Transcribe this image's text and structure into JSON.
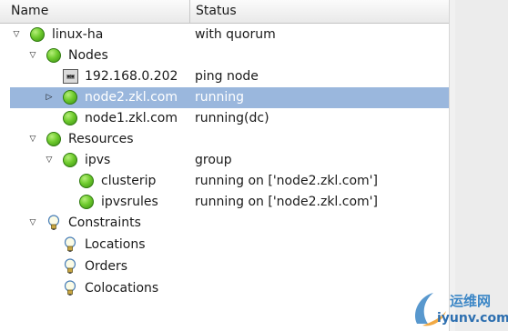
{
  "columns": {
    "name": "Name",
    "status": "Status"
  },
  "tree": {
    "root": {
      "label": "linux-ha",
      "status": "with quorum"
    },
    "nodes": {
      "label": "Nodes"
    },
    "ping_node": {
      "label": "192.168.0.202",
      "status": "ping node"
    },
    "node2": {
      "label": "node2.zkl.com",
      "status": "running"
    },
    "node1": {
      "label": "node1.zkl.com",
      "status": "running(dc)"
    },
    "resources": {
      "label": "Resources"
    },
    "ipvs": {
      "label": "ipvs",
      "status": "group"
    },
    "clusterip": {
      "label": "clusterip",
      "status": "running on ['node2.zkl.com']"
    },
    "ipvsrules": {
      "label": "ipvsrules",
      "status": "running on ['node2.zkl.com']"
    },
    "constraints": {
      "label": "Constraints"
    },
    "locations": {
      "label": "Locations"
    },
    "orders": {
      "label": "Orders"
    },
    "colocations": {
      "label": "Colocations"
    }
  },
  "watermark": {
    "cn": "运维网",
    "en": "iyunv.com"
  },
  "colors": {
    "selection": "#9ab7dd",
    "status_running": "#6fcb2e",
    "watermark": "#3b86c6"
  },
  "icons": {
    "expanded": "triangle-down-icon",
    "collapsed": "triangle-right-icon",
    "status": "green-status-dot-icon",
    "constraint": "lightbulb-icon",
    "host": "computer-host-icon"
  }
}
